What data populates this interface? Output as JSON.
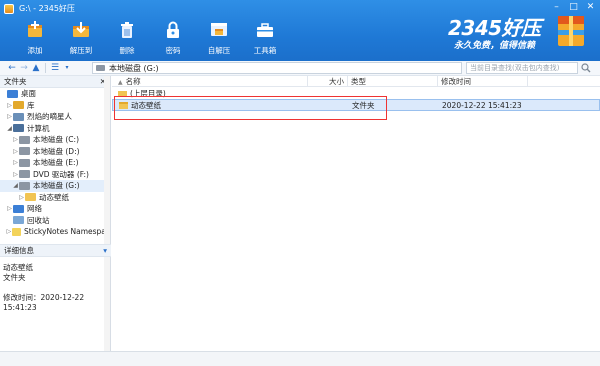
{
  "window": {
    "title": "G:\\ - 2345好压"
  },
  "toolbar": {
    "items": [
      {
        "label": "添加",
        "icon": "add-archive-icon"
      },
      {
        "label": "解压到",
        "icon": "extract-to-icon"
      },
      {
        "label": "删除",
        "icon": "delete-icon"
      },
      {
        "label": "密码",
        "icon": "password-icon"
      },
      {
        "label": "自解压",
        "icon": "self-extract-icon"
      },
      {
        "label": "工具箱",
        "icon": "toolbox-icon"
      }
    ]
  },
  "brand": {
    "logo": "2345好压",
    "slogan": "永久免费，值得信赖"
  },
  "address": {
    "path": "本地磁盘 (G:)"
  },
  "search": {
    "placeholder": "当前目录查找(双击包内查找)"
  },
  "sidebar": {
    "header": "文件夹",
    "items": [
      {
        "label": "桌面",
        "indent": 0,
        "arrow": "",
        "icon": "desktop-icon"
      },
      {
        "label": "库",
        "indent": 1,
        "arrow": "▷",
        "icon": "library-icon"
      },
      {
        "label": "烈焰的嘀星人",
        "indent": 1,
        "arrow": "▷",
        "icon": "user-icon"
      },
      {
        "label": "计算机",
        "indent": 1,
        "arrow": "◢",
        "icon": "computer-icon"
      },
      {
        "label": "本地磁盘 (C:)",
        "indent": 2,
        "arrow": "▷",
        "icon": "drive-icon"
      },
      {
        "label": "本地磁盘 (D:)",
        "indent": 2,
        "arrow": "▷",
        "icon": "drive-icon"
      },
      {
        "label": "本地磁盘 (E:)",
        "indent": 2,
        "arrow": "▷",
        "icon": "drive-icon"
      },
      {
        "label": "DVD 驱动器 (F:)",
        "indent": 2,
        "arrow": "▷",
        "icon": "dvd-icon"
      },
      {
        "label": "本地磁盘 (G:)",
        "indent": 2,
        "arrow": "◢",
        "icon": "drive-icon",
        "selected": true
      },
      {
        "label": "动态壁纸",
        "indent": 3,
        "arrow": "▷",
        "icon": "folder-icon"
      },
      {
        "label": "网络",
        "indent": 1,
        "arrow": "▷",
        "icon": "network-icon"
      },
      {
        "label": "回收站",
        "indent": 1,
        "arrow": "",
        "icon": "recycle-bin-icon"
      },
      {
        "label": "StickyNotes Namespac",
        "indent": 1,
        "arrow": "▷",
        "icon": "sticky-notes-icon"
      }
    ]
  },
  "details": {
    "header": "详细信息",
    "name": "动态壁纸",
    "type": "文件夹",
    "modified": "修改时间：2020-12-22 15:41:23"
  },
  "list": {
    "columns": {
      "name": "名称",
      "size": "大小",
      "type": "类型",
      "date": "修改时间"
    },
    "rows": [
      {
        "name": "(上层目录)",
        "size": "",
        "type": "",
        "date": ""
      },
      {
        "name": "动态壁纸",
        "size": "",
        "type": "文件夹",
        "date": "2020-12-22 15:41:23",
        "selected": true
      }
    ]
  },
  "colors": {
    "ribbon": "#1f79d6",
    "highlight": "#e33333",
    "selection": "#dbe9fb"
  }
}
